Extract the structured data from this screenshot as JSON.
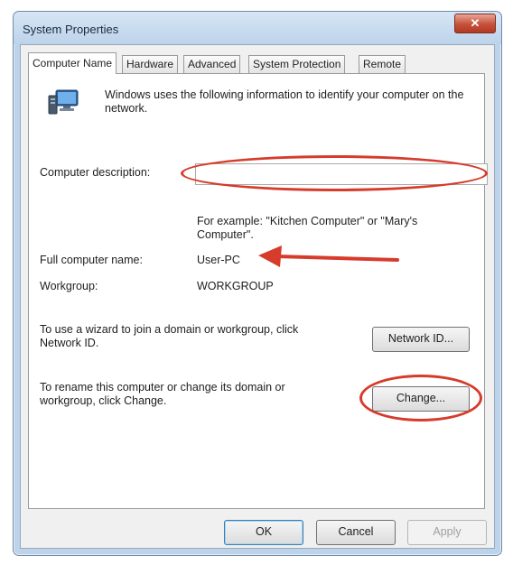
{
  "window": {
    "title": "System Properties",
    "close_glyph": "✕"
  },
  "tabs": [
    {
      "label": "Computer Name",
      "active": true
    },
    {
      "label": "Hardware",
      "active": false
    },
    {
      "label": "Advanced",
      "active": false
    },
    {
      "label": "System Protection",
      "active": false
    },
    {
      "label": "Remote",
      "active": false
    }
  ],
  "panel": {
    "info_text": "Windows uses the following information to identify your computer on the network.",
    "description_label": "Computer description:",
    "description_value": "",
    "example_text": "For example: \"Kitchen Computer\" or \"Mary's Computer\".",
    "full_name_label": "Full computer name:",
    "full_name_value": "User-PC",
    "workgroup_label": "Workgroup:",
    "workgroup_value": "WORKGROUP",
    "network_id_text": "To use a wizard to join a domain or workgroup, click Network ID.",
    "network_id_button": "Network ID...",
    "rename_text": "To rename this computer or change its domain or workgroup, click Change.",
    "change_button": "Change..."
  },
  "footer": {
    "ok": "OK",
    "cancel": "Cancel",
    "apply": "Apply"
  },
  "annotations": {
    "highlight_color": "#d63b2b",
    "highlights": [
      "computer-description-input",
      "change-button"
    ],
    "arrow_target": "full-computer-name-value"
  }
}
